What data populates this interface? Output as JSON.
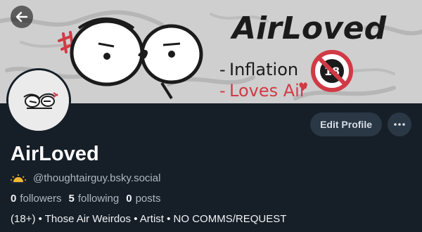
{
  "banner": {
    "title": "AirLoved",
    "subtitle_line1": "Inflation",
    "subtitle_line2": "Loves Air",
    "age_badge": "18",
    "colors": {
      "background": "#cfcfcf",
      "accent_red": "#d13a45",
      "ink": "#1b1b1b"
    }
  },
  "nav": {
    "back_icon": "arrow-left-icon"
  },
  "profile": {
    "display_name": "AirLoved",
    "handle": "@thoughtairguy.bsky.social",
    "handle_icon": "sunrise-icon",
    "stats": {
      "followers_count": "0",
      "followers_label": "followers",
      "following_count": "5",
      "following_label": "following",
      "posts_count": "0",
      "posts_label": "posts"
    },
    "bio": "(18+) • Those Air Weirdos • Artist • NO COMMS/REQUEST"
  },
  "actions": {
    "edit_profile_label": "Edit Profile",
    "more_icon": "more-horizontal-icon"
  },
  "theme": {
    "page_bg": "#161e27",
    "button_bg": "#2a3745",
    "muted_text": "#aeb8c3"
  }
}
